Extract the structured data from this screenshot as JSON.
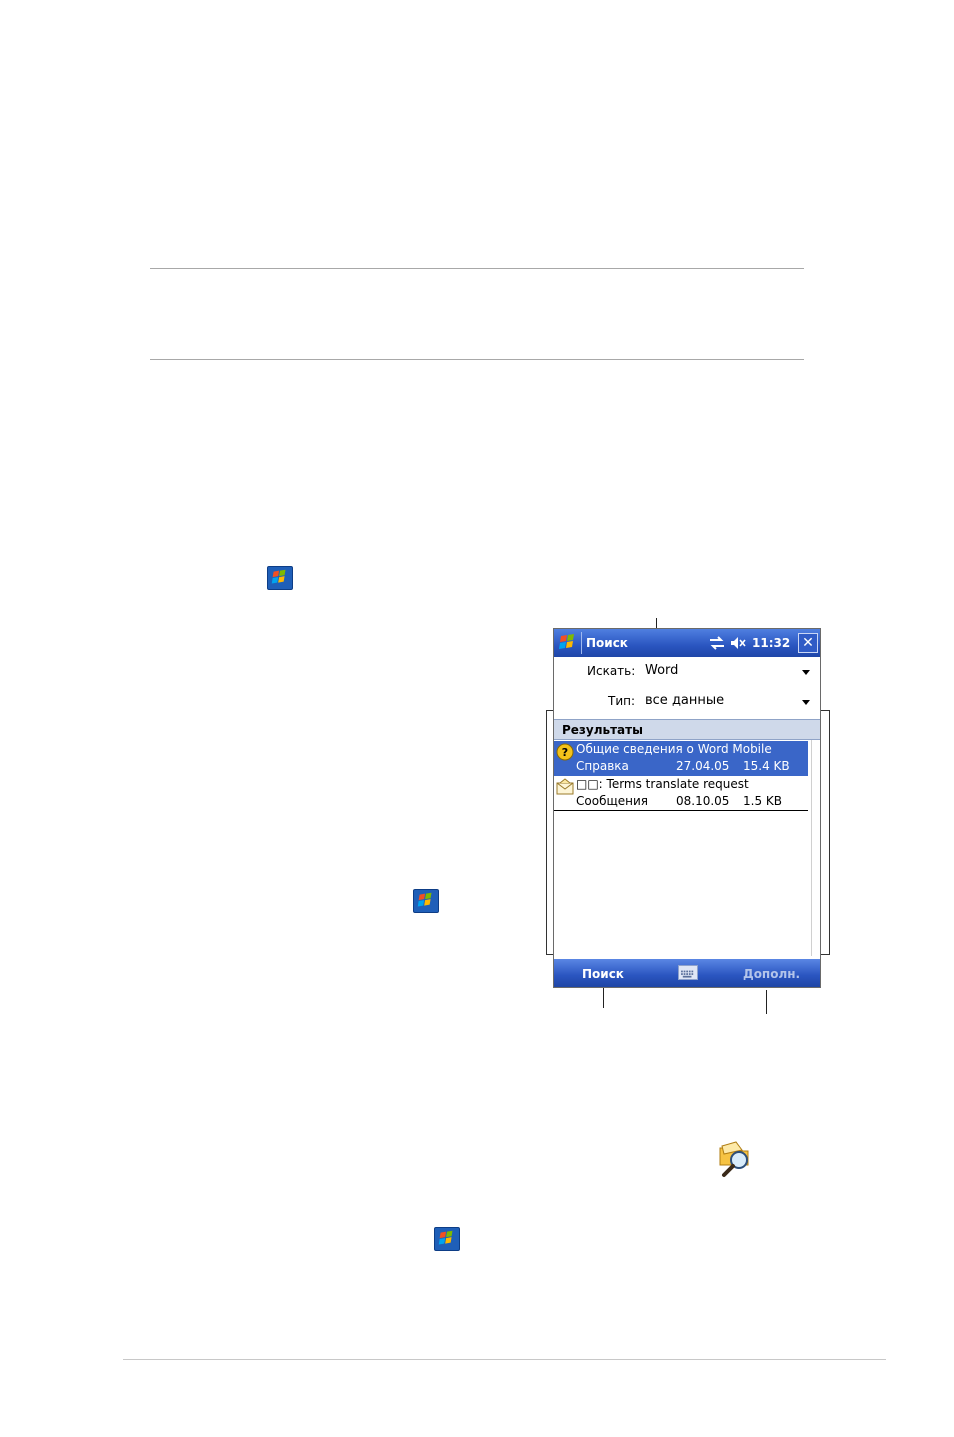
{
  "device": {
    "title": "Поиск",
    "time": "11:32",
    "close": "✕",
    "search_label": "Искать:",
    "search_value": "Word",
    "type_label": "Тип:",
    "type_value": "все данные",
    "results_header": "Результаты",
    "results": [
      {
        "title": "Общие сведения о Word Mobile",
        "category": "Справка",
        "date": "27.04.05",
        "size": "15.4 KB",
        "icon": "help-icon",
        "selected": true
      },
      {
        "title": "□□: Terms translate request",
        "category": "Сообщения",
        "date": "08.10.05",
        "size": "1.5  KB",
        "icon": "envelope-icon",
        "selected": false
      }
    ],
    "softkey_left": "Поиск",
    "softkey_right": "Дополн."
  },
  "colors": {
    "titlebar": "#2a55c0",
    "selection": "#3a66c8",
    "results_header": "#cfd9ea"
  }
}
